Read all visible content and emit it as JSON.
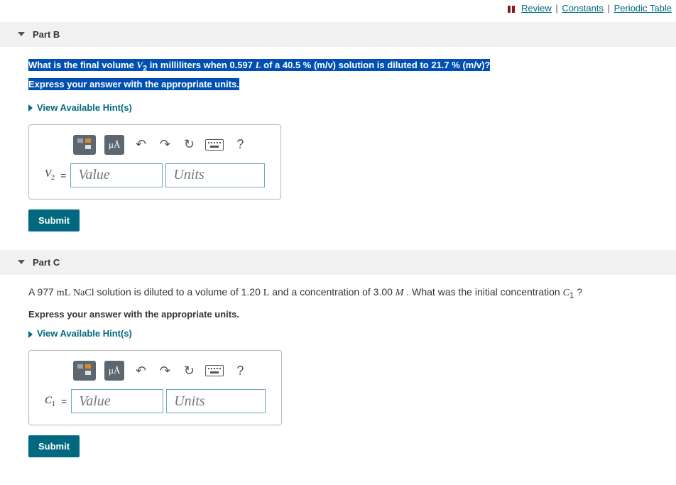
{
  "top_links": {
    "review": "Review",
    "constants": "Constants",
    "periodic": "Periodic Table"
  },
  "partB": {
    "title": "Part B",
    "question_line1_a": "What is the final volume ",
    "question_line1_var": "V",
    "question_line1_sub": "2",
    "question_line1_b": " in milliliters when 0.597 ",
    "question_line1_unit": "L",
    "question_line1_c": " of a 40.5 ",
    "question_line1_pct1": "%",
    "question_line1_d": " (m/v) solution is diluted to 21.7 ",
    "question_line1_pct2": "%",
    "question_line1_e": " (m/v)?",
    "question_line2": "Express your answer with the appropriate units.",
    "hints": "View Available Hint(s)",
    "var": "V",
    "var_sub": "2",
    "value_ph": "Value",
    "units_ph": "Units",
    "units_btn": "μÅ",
    "help": "?",
    "submit": "Submit"
  },
  "partC": {
    "title": "Part C",
    "q_a": "A 977 ",
    "q_unit1": "mL",
    "q_b": " ",
    "q_formula": "NaCl",
    "q_c": " solution is diluted to a volume of 1.20 ",
    "q_unit2": "L",
    "q_d": " and a concentration of 3.00 ",
    "q_unit3": "M",
    "q_e": " . What was the initial concentration ",
    "q_var": "C",
    "q_sub": "1",
    "q_f": " ?",
    "instr": "Express your answer with the appropriate units.",
    "hints": "View Available Hint(s)",
    "var": "C",
    "var_sub": "1",
    "value_ph": "Value",
    "units_ph": "Units",
    "units_btn": "μÅ",
    "help": "?",
    "submit": "Submit"
  }
}
